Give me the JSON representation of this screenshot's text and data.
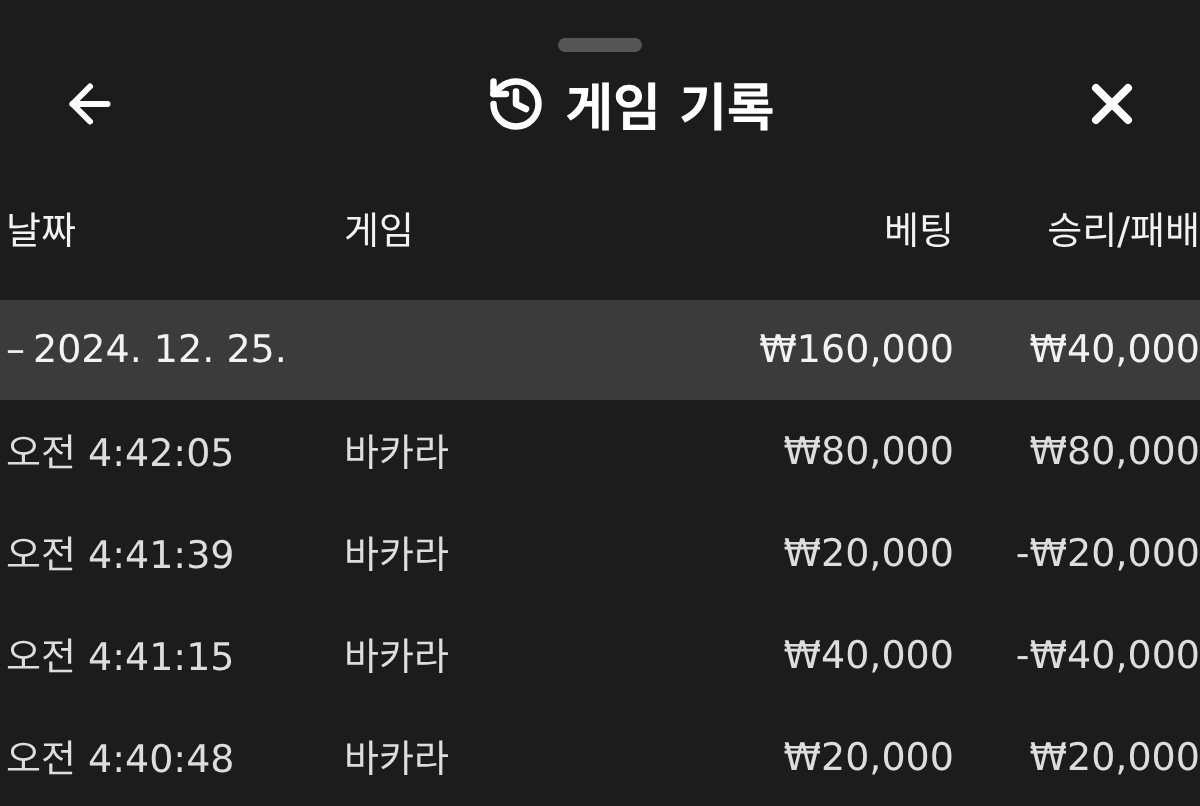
{
  "header": {
    "title": "게임 기록"
  },
  "table": {
    "columns": [
      "날짜",
      "게임",
      "베팅",
      "승리/패배"
    ],
    "group": {
      "toggle": "–",
      "date": "2024. 12. 25.",
      "bet": "₩160,000",
      "result": "₩40,000"
    },
    "rows": [
      {
        "time": "오전 4:42:05",
        "game": "바카라",
        "bet": "₩80,000",
        "result": "₩80,000"
      },
      {
        "time": "오전 4:41:39",
        "game": "바카라",
        "bet": "₩20,000",
        "result": "-₩20,000"
      },
      {
        "time": "오전 4:41:15",
        "game": "바카라",
        "bet": "₩40,000",
        "result": "-₩40,000"
      },
      {
        "time": "오전 4:40:48",
        "game": "바카라",
        "bet": "₩20,000",
        "result": "₩20,000"
      }
    ]
  }
}
